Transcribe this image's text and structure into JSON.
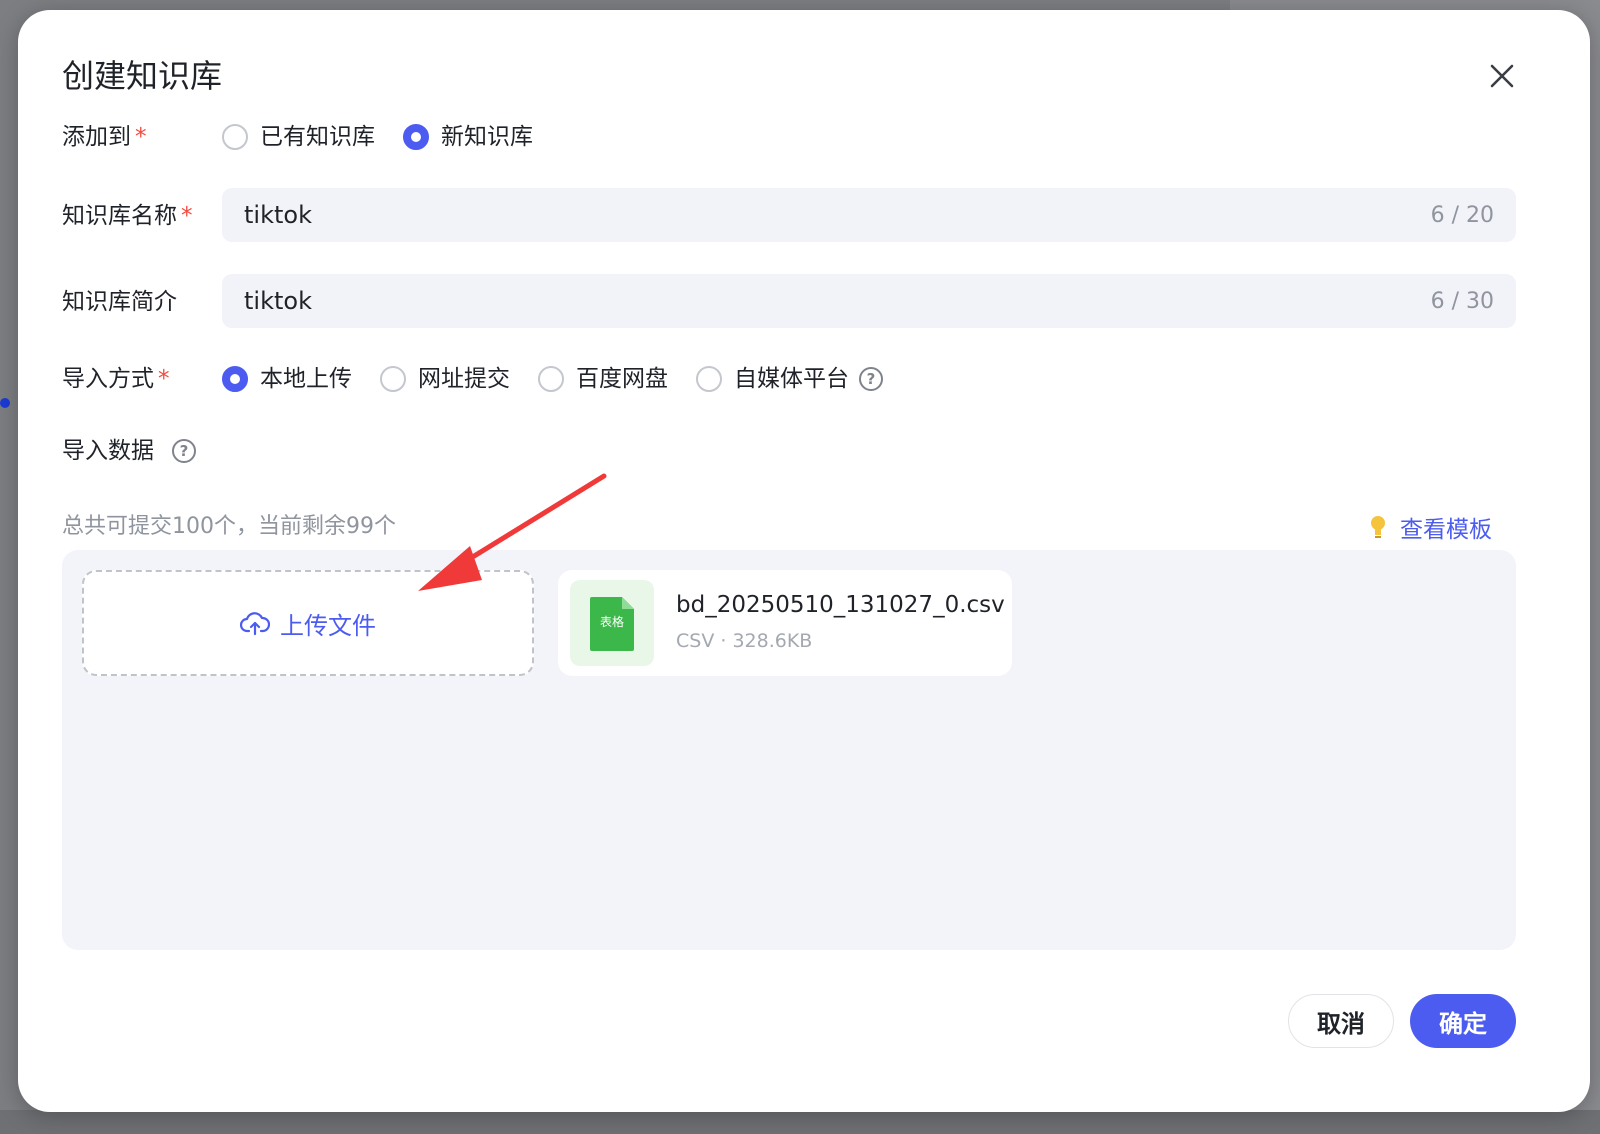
{
  "dialog": {
    "title": "创建知识库",
    "add_to": {
      "label": "添加到",
      "required_mark": "*",
      "options": [
        "已有知识库",
        "新知识库"
      ],
      "selected": "新知识库"
    },
    "name": {
      "label": "知识库名称",
      "required_mark": "*",
      "value": "tiktok",
      "counter": "6 / 20"
    },
    "description": {
      "label": "知识库简介",
      "value": "tiktok",
      "counter": "6 / 30"
    },
    "import_method": {
      "label": "导入方式",
      "required_mark": "*",
      "options": [
        "本地上传",
        "网址提交",
        "百度网盘",
        "自媒体平台"
      ],
      "selected": "本地上传",
      "help_icon": "?"
    },
    "import_data": {
      "label": "导入数据",
      "help_icon": "?"
    },
    "quota_hint": "总共可提交100个，当前剩余99个",
    "template_link": "查看模板",
    "upload_button": "上传文件",
    "file": {
      "name": "bd_20250510_131027_0.csv",
      "meta": "CSV · 328.6KB",
      "icon_text": "表格"
    },
    "cancel_label": "取消",
    "confirm_label": "确定"
  },
  "colors": {
    "accent": "#4d5cf0",
    "required": "#f5493d",
    "file_icon": "#3cb84a"
  },
  "icons": [
    "close-icon",
    "help-icon",
    "lightbulb-icon",
    "cloud-upload-icon",
    "spreadsheet-file-icon",
    "annotation-arrow"
  ]
}
